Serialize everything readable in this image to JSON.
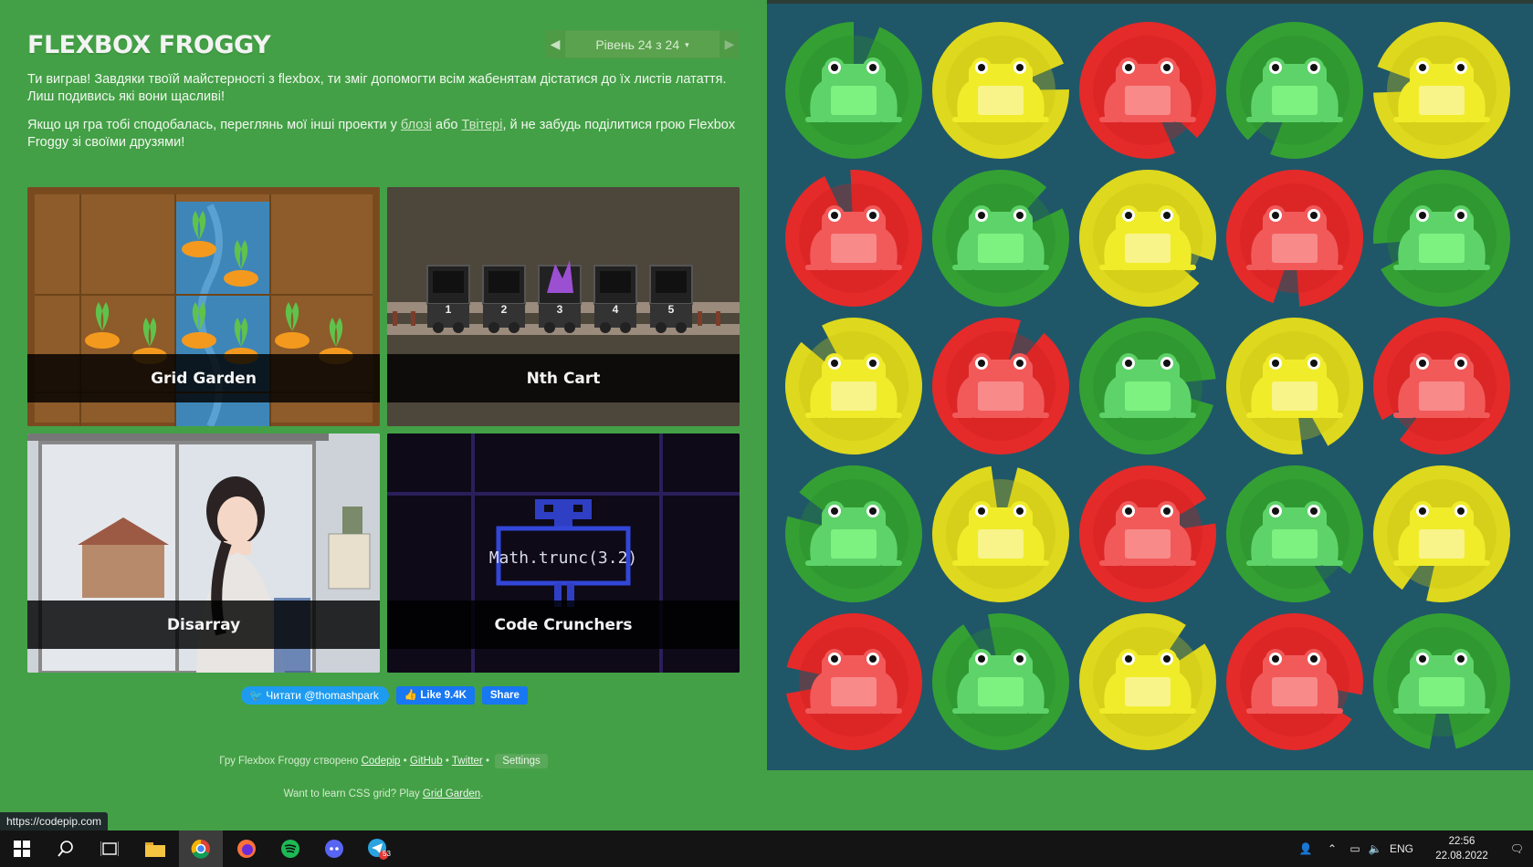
{
  "app": {
    "title": "FLEXBOX FROGGY",
    "level": "Рівень 24 з 24",
    "level_caret": "▾"
  },
  "intro": {
    "paragraph1": "Ти виграв! Завдяки твоїй майстерності з flexbox, ти зміг допомогти всім жабенятам дістатися до їх листів латаття. Лиш подивись які вони щасливі!",
    "paragraph2_before": "Якщо ця гра тобі сподобалась, переглянь мої інші проекти у ",
    "link_blog": "блозі",
    "paragraph2_mid": " або ",
    "link_twitter": "Твітері",
    "paragraph2_after": ", й не забудь поділитися грою Flexbox Froggy зі своїми друзями!"
  },
  "projects": [
    {
      "label": "Grid Garden"
    },
    {
      "label": "Nth Cart"
    },
    {
      "label": "Disarray"
    },
    {
      "label": "Code Crunchers"
    }
  ],
  "nth_cart": {
    "numbers": [
      "1",
      "2",
      "3",
      "4",
      "5"
    ]
  },
  "code_crunchers": {
    "code": "Math.trunc(3.2)"
  },
  "share": {
    "twitter_label": "Читати @thomashpark",
    "like_label": "Like 9.4K",
    "share_label": "Share"
  },
  "footer": {
    "credit_prefix": "Гру Flexbox Froggy створено ",
    "link_codepip": "Codepip",
    "link_github": "GitHub",
    "link_twitter": "Twitter",
    "separator": " • ",
    "settings_label": "Settings",
    "grid_prefix": "Want to learn CSS grid? Play ",
    "link_grid_garden": "Grid Garden",
    "grid_suffix": "."
  },
  "status_url": "https://codepip.com",
  "pond": {
    "rows": [
      [
        "green",
        "yellow",
        "red",
        "green",
        "yellow"
      ],
      [
        "red",
        "green",
        "yellow",
        "red",
        "green"
      ],
      [
        "yellow",
        "red",
        "green",
        "yellow",
        "red"
      ],
      [
        "green",
        "yellow",
        "red",
        "green",
        "yellow"
      ],
      [
        "red",
        "green",
        "yellow",
        "red",
        "green"
      ]
    ]
  },
  "colors": {
    "green": {
      "pad": "#34a034",
      "pad_dark": "#2b8a2f",
      "frog": "#5ed36a",
      "belly": "#7ef281"
    },
    "yellow": {
      "pad": "#ded81e",
      "pad_dark": "#c8c214",
      "frog": "#f0ec2a",
      "belly": "#f8f48a"
    },
    "red": {
      "pad": "#e52a2a",
      "pad_dark": "#cc2020",
      "frog": "#f25a5a",
      "belly": "#f88a8a"
    }
  },
  "taskbar": {
    "telegram_badge": "53",
    "lang": "ENG",
    "time": "22:56",
    "date": "22.08.2022"
  }
}
